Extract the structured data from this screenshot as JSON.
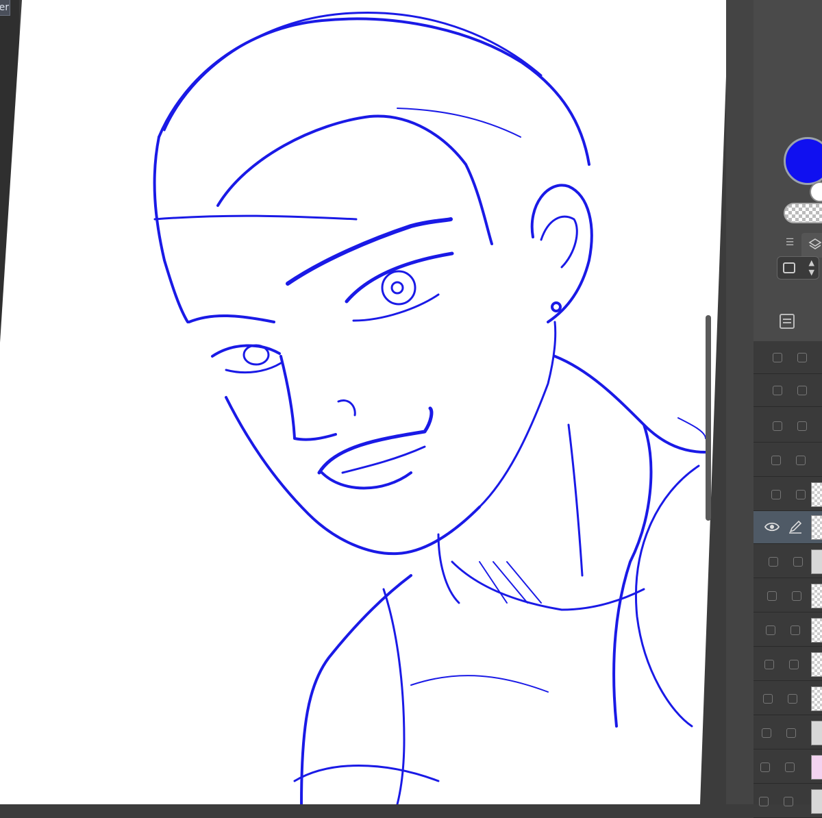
{
  "app": {
    "top_left_tab_label": "er"
  },
  "colors": {
    "main_color": "#1010f0",
    "sub_color": "#ffffff",
    "sketch_stroke": "#1a1ae6"
  },
  "layer_panel": {
    "rows": [
      {
        "visible": false,
        "editable": false
      },
      {
        "visible": false,
        "editable": false
      },
      {
        "visible": false,
        "editable": false
      },
      {
        "visible": false,
        "editable": false
      },
      {
        "visible": false,
        "editable": false
      },
      {
        "visible": true,
        "editable": true,
        "active": true
      },
      {
        "visible": false,
        "editable": false
      },
      {
        "visible": false,
        "editable": false
      },
      {
        "visible": false,
        "editable": false
      },
      {
        "visible": false,
        "editable": false
      },
      {
        "visible": false,
        "editable": false
      },
      {
        "visible": false,
        "editable": false
      },
      {
        "visible": false,
        "editable": false
      },
      {
        "visible": false,
        "editable": false
      }
    ]
  }
}
